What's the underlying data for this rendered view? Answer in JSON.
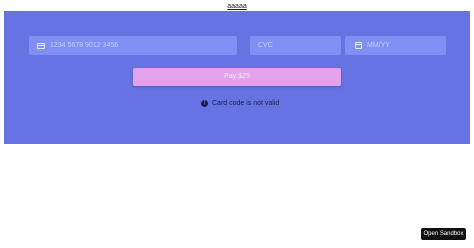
{
  "top": {
    "link_text": "aaaaa"
  },
  "form": {
    "card_number_placeholder": "1234 5678 9012 3456",
    "cvc_placeholder": "CVC",
    "expiry_placeholder": "MM/YY",
    "pay_label": "Pay $25",
    "error_icon": "!",
    "error_text": "Card code is not valid"
  },
  "footer": {
    "sandbox_label": "Open Sandbox"
  },
  "colors": {
    "panel": "#6773e3",
    "field": "#7f8ff4",
    "pay_button": "#e5a2ec",
    "sandbox_button": "#111111"
  },
  "icons": {
    "card": "credit-card-icon",
    "calendar": "calendar-icon",
    "error": "warning-icon"
  }
}
